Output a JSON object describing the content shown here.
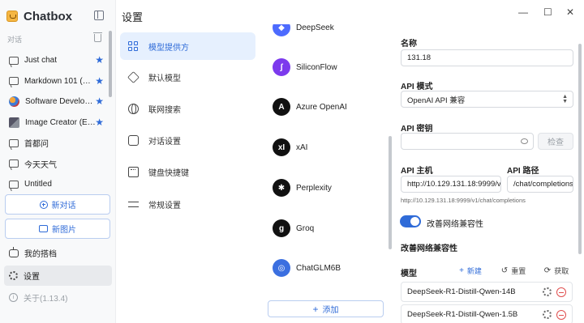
{
  "app": {
    "name": "Chatbox"
  },
  "sidebar": {
    "section_label": "对话",
    "chats": [
      {
        "label": "Just chat",
        "starred": true,
        "icon": "chat-bubble-icon"
      },
      {
        "label": "Markdown 101 (…",
        "starred": true,
        "icon": "chat-bubble-icon"
      },
      {
        "label": "Software Develo…",
        "starred": true,
        "icon": "avatar-software"
      },
      {
        "label": "Image Creator (E…",
        "starred": true,
        "icon": "image-creator-icon"
      },
      {
        "label": "首都问",
        "starred": false,
        "icon": "chat-bubble-icon"
      },
      {
        "label": "今天天气",
        "starred": false,
        "icon": "chat-bubble-icon"
      },
      {
        "label": "Untitled",
        "starred": false,
        "icon": "chat-bubble-icon"
      }
    ],
    "new_chat_label": "新对话",
    "new_image_label": "新图片",
    "my_partners_label": "我的搭档",
    "settings_label": "设置",
    "about_label": "关于(1.13.4)"
  },
  "header": {
    "title": "设置",
    "win_minimize": "—",
    "win_maximize": "☐",
    "win_close": "✕"
  },
  "menu": {
    "items": [
      {
        "label": "模型提供方",
        "icon": "grid-icon",
        "active": true
      },
      {
        "label": "默认模型",
        "icon": "cube-icon",
        "active": false
      },
      {
        "label": "联网搜索",
        "icon": "globe-icon",
        "active": false
      },
      {
        "label": "对话设置",
        "icon": "chat-settings-icon",
        "active": false
      },
      {
        "label": "键盘快捷键",
        "icon": "keyboard-icon",
        "active": false
      },
      {
        "label": "常规设置",
        "icon": "sliders-icon",
        "active": false
      }
    ]
  },
  "providers": {
    "items": [
      {
        "name": "DeepSeek",
        "color": "#4d6bfe",
        "glyph": "◆"
      },
      {
        "name": "SiliconFlow",
        "color": "#7c3aed",
        "glyph": "ʃ"
      },
      {
        "name": "Azure OpenAI",
        "color": "#111111",
        "glyph": "A"
      },
      {
        "name": "xAI",
        "color": "#111111",
        "glyph": "xI"
      },
      {
        "name": "Perplexity",
        "color": "#111111",
        "glyph": "✱"
      },
      {
        "name": "Groq",
        "color": "#111111",
        "glyph": "g"
      },
      {
        "name": "ChatGLM6B",
        "color": "#3b6fe0",
        "glyph": "◎"
      }
    ],
    "add_label": "添加"
  },
  "config": {
    "name_label": "名称",
    "name_value": "131.18",
    "api_mode_label": "API 模式",
    "api_mode_value": "OpenAI API 兼容",
    "api_key_label": "API 密钥",
    "api_key_value": "",
    "check_label": "检查",
    "api_host_label": "API 主机",
    "api_host_value": "http://10.129.131.18:9999/v",
    "api_path_label": "API 路径",
    "api_path_value": "/chat/completions",
    "full_url": "http://10.129.131.18:9999/v1/chat/completions",
    "improve_toggle_label": "改善网络兼容性",
    "improve_toggle_on": true,
    "improve_section_label": "改善网络兼容性",
    "models_label": "模型",
    "new_label": "新建",
    "reset_label": "重置",
    "fetch_label": "获取",
    "models": [
      "DeepSeek-R1-Distill-Qwen-14B",
      "DeepSeek-R1-Distill-Qwen-1.5B"
    ]
  },
  "colors": {
    "accent": "#2f6bd8",
    "danger": "#e04f4f",
    "active_bg": "#e6f0fe"
  }
}
